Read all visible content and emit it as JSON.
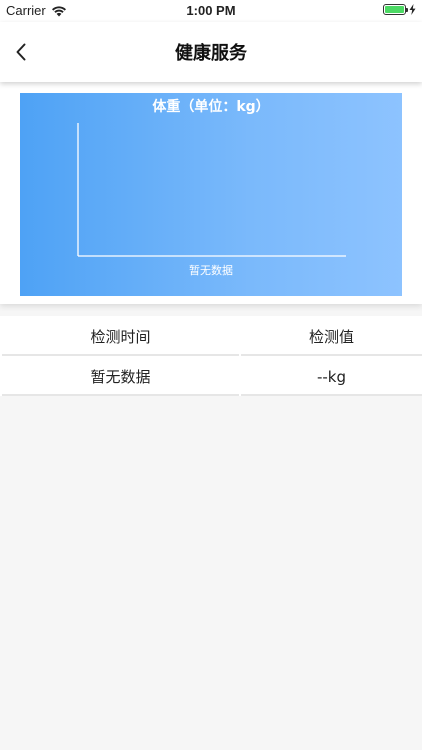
{
  "status_bar": {
    "carrier": "Carrier",
    "time": "1:00 PM"
  },
  "nav": {
    "title": "健康服务",
    "back_icon": "chevron-left-icon"
  },
  "chart_data": {
    "type": "line",
    "title": "体重（单位：kg）",
    "empty_text": "暂无数据",
    "series": [],
    "grid": false
  },
  "table": {
    "headers": [
      "检测时间",
      "检测值"
    ],
    "rows": [
      [
        "暂无数据",
        "--kg"
      ]
    ]
  },
  "colors": {
    "chart_gradient_start": "#4ea2f5",
    "chart_gradient_end": "#8dc3ff",
    "battery": "#4cd964",
    "background": "#f6f6f6"
  }
}
